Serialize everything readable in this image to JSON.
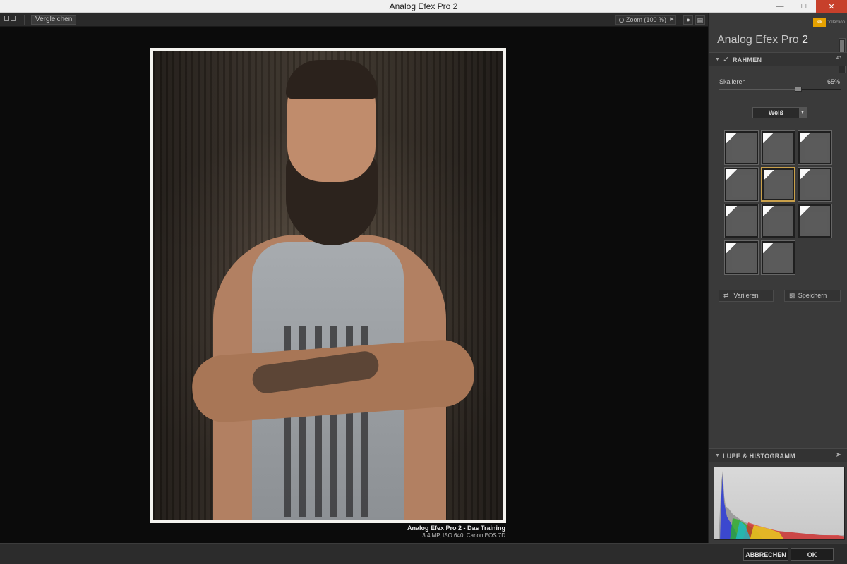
{
  "window": {
    "title": "Analog Efex Pro 2"
  },
  "toolbar": {
    "compare_label": "Vergleichen",
    "zoom_label": "Zoom (100 %)"
  },
  "image": {
    "caption_title": "Analog Efex Pro 2 - Das Training",
    "caption_info": "3.4 MP, ISO 640, Canon EOS 7D"
  },
  "panel": {
    "brand_sub": "Collection",
    "title_main": "Analog Efex Pro",
    "title_num": "2",
    "frame_section": {
      "label": "RAHMEN",
      "slider_label": "Skalieren",
      "slider_value": "65%",
      "slider_level": 0.65,
      "dropdown_value": "Weiß",
      "frames_count": 11,
      "selected_frame_index": 4
    },
    "buttons": {
      "vary": "Variieren",
      "save": "Speichern"
    },
    "histogram_section": {
      "label": "LUPE & HISTOGRAMM"
    }
  },
  "footer": {
    "cancel": "ABBRECHEN",
    "ok": "OK"
  },
  "colors": {
    "accent": "#c9a04a",
    "panel_bg": "#3a3a3a",
    "canvas_bg": "#0b0b0b"
  }
}
